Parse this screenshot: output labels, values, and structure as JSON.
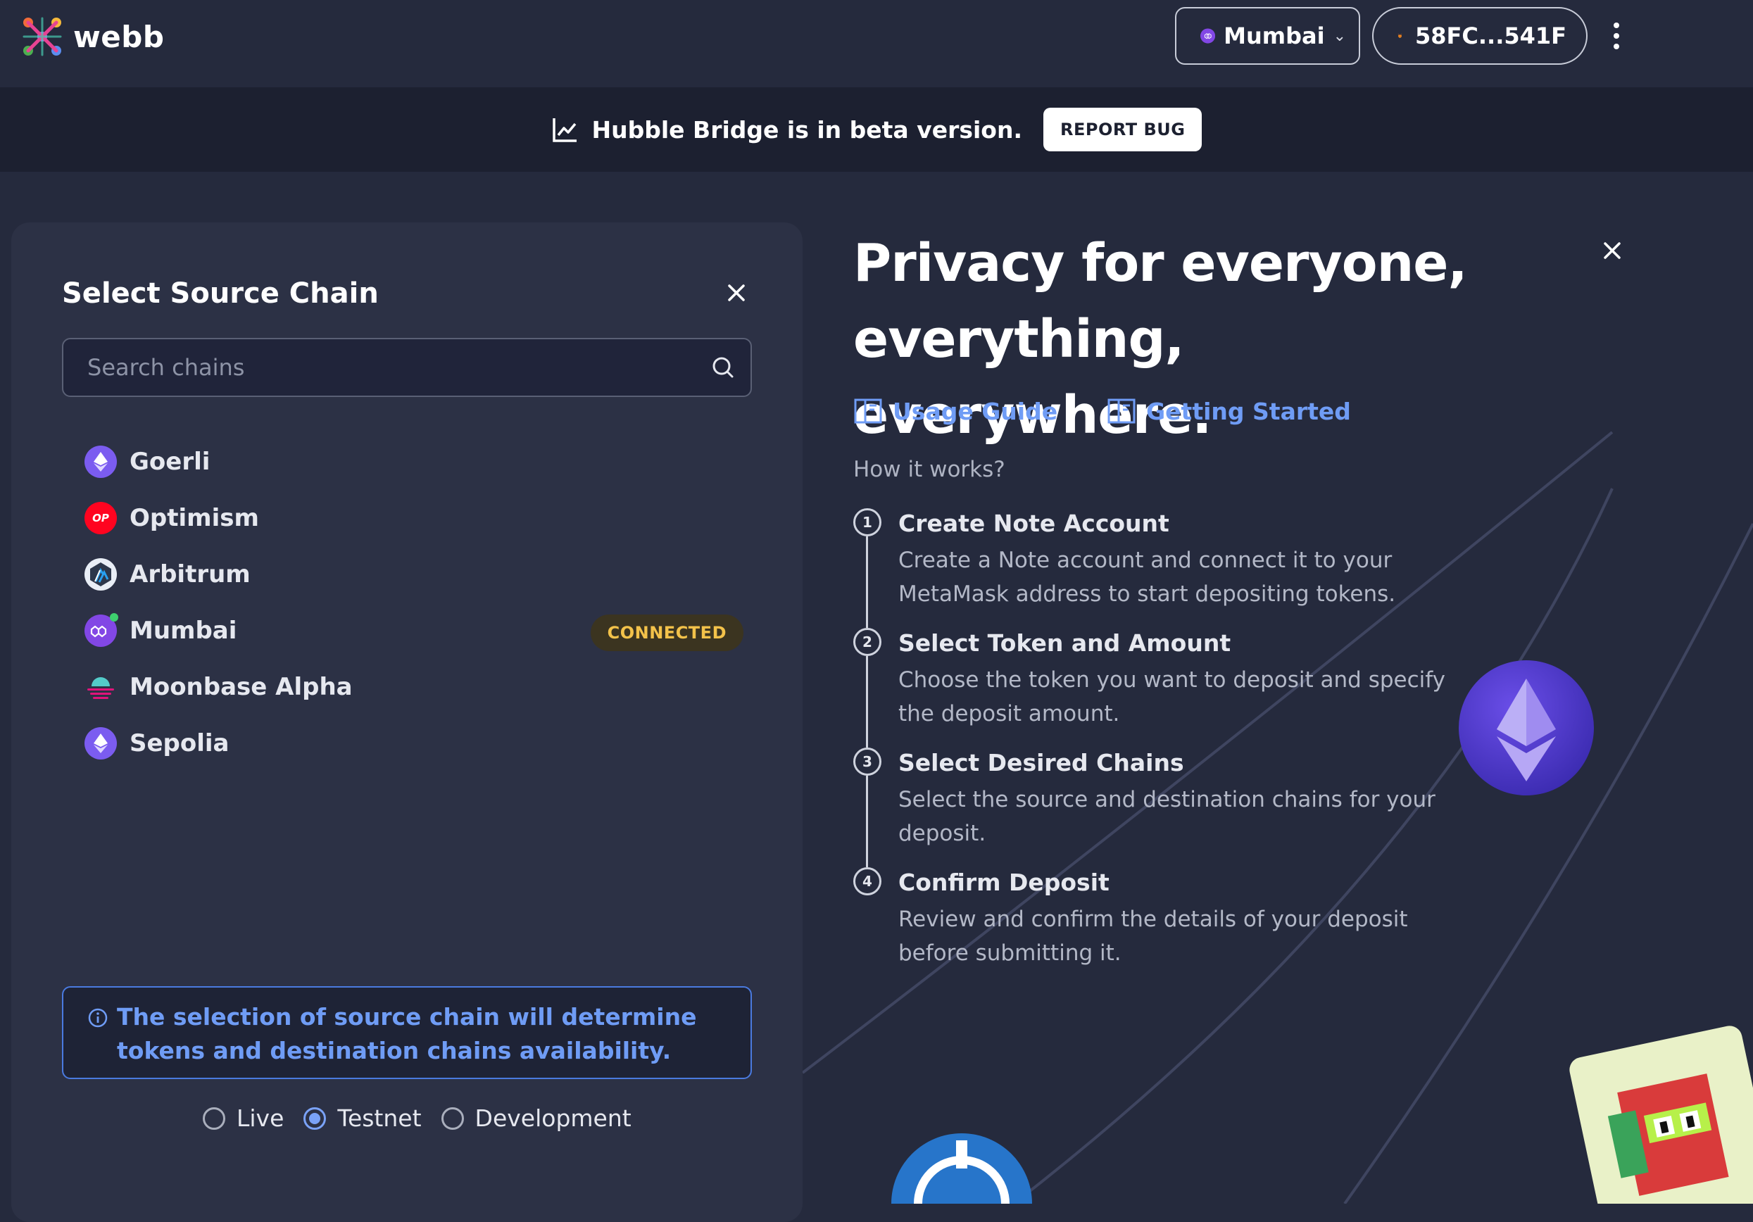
{
  "header": {
    "logo_text": "webb",
    "network": "Mumbai",
    "wallet_address": "58FC...541F"
  },
  "banner": {
    "message": "Hubble Bridge is in beta version.",
    "report_label": "REPORT BUG"
  },
  "source_panel": {
    "title": "Select Source Chain",
    "search_placeholder": "Search chains",
    "chains": [
      {
        "name": "Goerli",
        "icon": "ethereum-icon",
        "color": "#7b5cf0"
      },
      {
        "name": "Optimism",
        "icon": "optimism-icon",
        "color": "#ff0420"
      },
      {
        "name": "Arbitrum",
        "icon": "arbitrum-icon",
        "color": "#2d374b"
      },
      {
        "name": "Mumbai",
        "icon": "polygon-icon",
        "color": "#8247e5",
        "status": "CONNECTED"
      },
      {
        "name": "Moonbase Alpha",
        "icon": "moonbase-icon",
        "color": "#53cbc9"
      },
      {
        "name": "Sepolia",
        "icon": "ethereum-icon",
        "color": "#7b5cf0"
      }
    ],
    "info": "The selection of source chain will determine tokens and destination chains availability.",
    "networks": [
      {
        "label": "Live",
        "checked": false
      },
      {
        "label": "Testnet",
        "checked": true
      },
      {
        "label": "Development",
        "checked": false
      }
    ]
  },
  "intro": {
    "title_line1": "Privacy for everyone,",
    "title_line2": "everything, everywhere.",
    "links": [
      {
        "label": "Usage Guide",
        "icon": "book-icon"
      },
      {
        "label": "Getting Started",
        "icon": "book-icon"
      }
    ],
    "how_label": "How it works?",
    "steps": [
      {
        "num": "1",
        "title": "Create Note Account",
        "desc": "Create a Note account and connect it to your MetaMask address to start depositing tokens."
      },
      {
        "num": "2",
        "title": "Select Token and Amount",
        "desc": "Choose the token you want to deposit and specify the deposit amount."
      },
      {
        "num": "3",
        "title": "Select Desired Chains",
        "desc": "Select the source and destination chains for your deposit."
      },
      {
        "num": "4",
        "title": "Confirm Deposit",
        "desc": "Review and confirm the details of your deposit before submitting it."
      }
    ]
  },
  "colors": {
    "background": "#252a3d",
    "panel": "#2c3145",
    "accent": "#6f9cf5",
    "connected": "#f3c24a"
  }
}
